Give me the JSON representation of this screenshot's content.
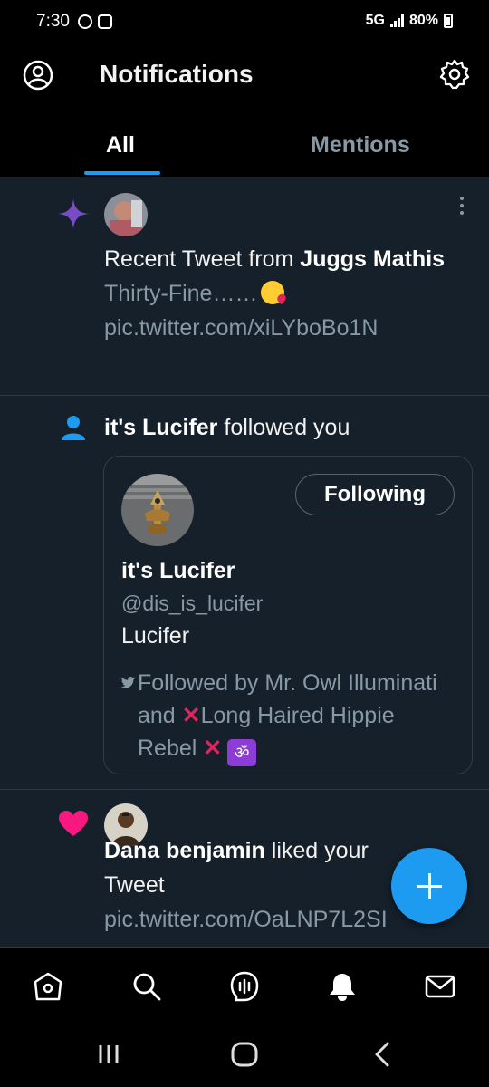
{
  "status_bar": {
    "time": "7:30",
    "network": "5G",
    "battery": "80%"
  },
  "header": {
    "title": "Notifications"
  },
  "tabs": [
    {
      "label": "All",
      "active": true
    },
    {
      "label": "Mentions",
      "active": false
    }
  ],
  "notifications": [
    {
      "type": "recommendation",
      "icon": "sparkle-icon",
      "prefix": "Recent Tweet from ",
      "user": "Juggs Mathis",
      "tweet_text": "Thirty-Fine……",
      "link": "pic.twitter.com/xiLYboBo1N"
    },
    {
      "type": "follow",
      "icon": "person-icon",
      "user": "it's Lucifer",
      "action": " followed you",
      "card": {
        "name": "it's Lucifer",
        "handle": "@dis_is_lucifer",
        "bio": "Lucifer",
        "follow_button": "Following",
        "followed_by_prefix": "Followed by Mr. Owl Illuminati and ",
        "followed_by_name2": "Long Haired Hippie Rebel "
      }
    },
    {
      "type": "like",
      "icon": "heart-icon",
      "user": "Dana benjamin",
      "action": " liked your",
      "line2": "Tweet",
      "link": "pic.twitter.com/OaLNP7L2SI"
    }
  ],
  "colors": {
    "background": "#15202b",
    "bar": "#000000",
    "accent": "#1d9bf0",
    "muted": "#8899a6",
    "sparkle": "#794bc4",
    "like": "#f91880"
  }
}
